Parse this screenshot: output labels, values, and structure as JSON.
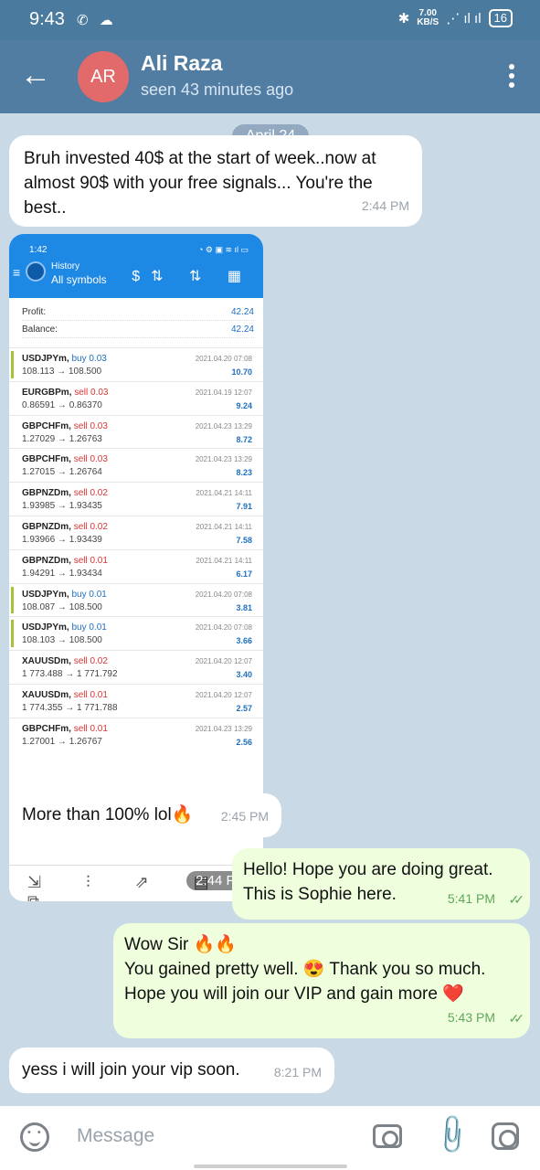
{
  "status_bar": {
    "time": "9:43",
    "left_icons": "✆ ☁",
    "speed_value": "7.00",
    "speed_unit": "KB/S",
    "signal": "⋰ ıl ıl",
    "battery": "16"
  },
  "header": {
    "back_icon": "←",
    "avatar_initials": "AR",
    "contact_name": "Ali Raza",
    "last_seen": "seen 43 minutes ago"
  },
  "chat": {
    "date_label": "April 24",
    "messages": [
      {
        "direction": "in",
        "text": "Bruh invested 40$ at the start of week..now at almost 90$ with your free signals... You're the best..",
        "time": "2:44 PM"
      },
      {
        "direction": "in",
        "text": "More than 100% lol🔥",
        "time": "2:45 PM"
      },
      {
        "direction": "out",
        "text": "Hello! Hope you are doing great. This is Sophie here.",
        "time": "5:41 PM"
      },
      {
        "direction": "out",
        "line1": "Wow Sir 🔥🔥",
        "line2": "You gained pretty well. 😍 Thank you so much.",
        "line3": "Hope you will join our VIP and gain more ❤️",
        "time": "5:43 PM"
      },
      {
        "direction": "in",
        "text": "yess i will join your vip soon.",
        "time": "8:21 PM"
      }
    ],
    "read_ticks": "✓✓"
  },
  "embedded_screenshot": {
    "time": "1:42",
    "status_icons": "◔ ⚙ ▣ ≋ ıl ▭",
    "menu_icon": "≡",
    "title": "History",
    "subtitle": "All symbols",
    "toolbar_icons": "$⇅ ⇅ ▦",
    "profit_label": "Profit:",
    "profit_value": "42.24",
    "balance_label": "Balance:",
    "balance_value": "42.24",
    "trades": [
      {
        "symbol": "USDJPYm,",
        "side": "buy 0.03",
        "type": "buy",
        "prices": "108.113 → 108.500",
        "datetime": "2021.04.20 07:08",
        "profit": "10.70"
      },
      {
        "symbol": "EURGBPm,",
        "side": "sell 0.03",
        "type": "sell",
        "prices": "0.86591 → 0.86370",
        "datetime": "2021.04.19 12:07",
        "profit": "9.24"
      },
      {
        "symbol": "GBPCHFm,",
        "side": "sell 0.03",
        "type": "sell",
        "prices": "1.27029 → 1.26763",
        "datetime": "2021.04.23 13:29",
        "profit": "8.72"
      },
      {
        "symbol": "GBPCHFm,",
        "side": "sell 0.03",
        "type": "sell",
        "prices": "1.27015 → 1.26764",
        "datetime": "2021.04.23 13:29",
        "profit": "8.23"
      },
      {
        "symbol": "GBPNZDm,",
        "side": "sell 0.02",
        "type": "sell",
        "prices": "1.93985 → 1.93435",
        "datetime": "2021.04.21 14:11",
        "profit": "7.91"
      },
      {
        "symbol": "GBPNZDm,",
        "side": "sell 0.02",
        "type": "sell",
        "prices": "1.93966 → 1.93439",
        "datetime": "2021.04.21 14:11",
        "profit": "7.58"
      },
      {
        "symbol": "GBPNZDm,",
        "side": "sell 0.01",
        "type": "sell",
        "prices": "1.94291 → 1.93434",
        "datetime": "2021.04.21 14:11",
        "profit": "6.17"
      },
      {
        "symbol": "USDJPYm,",
        "side": "buy 0.01",
        "type": "buy",
        "prices": "108.087 → 108.500",
        "datetime": "2021.04.20 07:08",
        "profit": "3.81"
      },
      {
        "symbol": "USDJPYm,",
        "side": "buy 0.01",
        "type": "buy",
        "prices": "108.103 → 108.500",
        "datetime": "2021.04.20 07:08",
        "profit": "3.66"
      },
      {
        "symbol": "XAUUSDm,",
        "side": "sell 0.02",
        "type": "sell",
        "prices": "1 773.488 → 1 771.792",
        "datetime": "2021.04.20 12:07",
        "profit": "3.40"
      },
      {
        "symbol": "XAUUSDm,",
        "side": "sell 0.01",
        "type": "sell",
        "prices": "1 774.355 → 1 771.788",
        "datetime": "2021.04.20 12:07",
        "profit": "2.57"
      },
      {
        "symbol": "GBPCHFm,",
        "side": "sell 0.01",
        "type": "sell",
        "prices": "1.27001 → 1.26767",
        "datetime": "2021.04.23 13:29",
        "profit": "2.56"
      }
    ],
    "nav_icons": "⇲ ⫶ ⇗ ▤ ⧉",
    "image_time": "2:44 PM"
  },
  "input": {
    "placeholder": "Message",
    "emoji_icon": "emoji-icon",
    "camera_icon": "camera-icon",
    "attach_icon": "📎",
    "instagram_icon": "instagram-icon"
  }
}
